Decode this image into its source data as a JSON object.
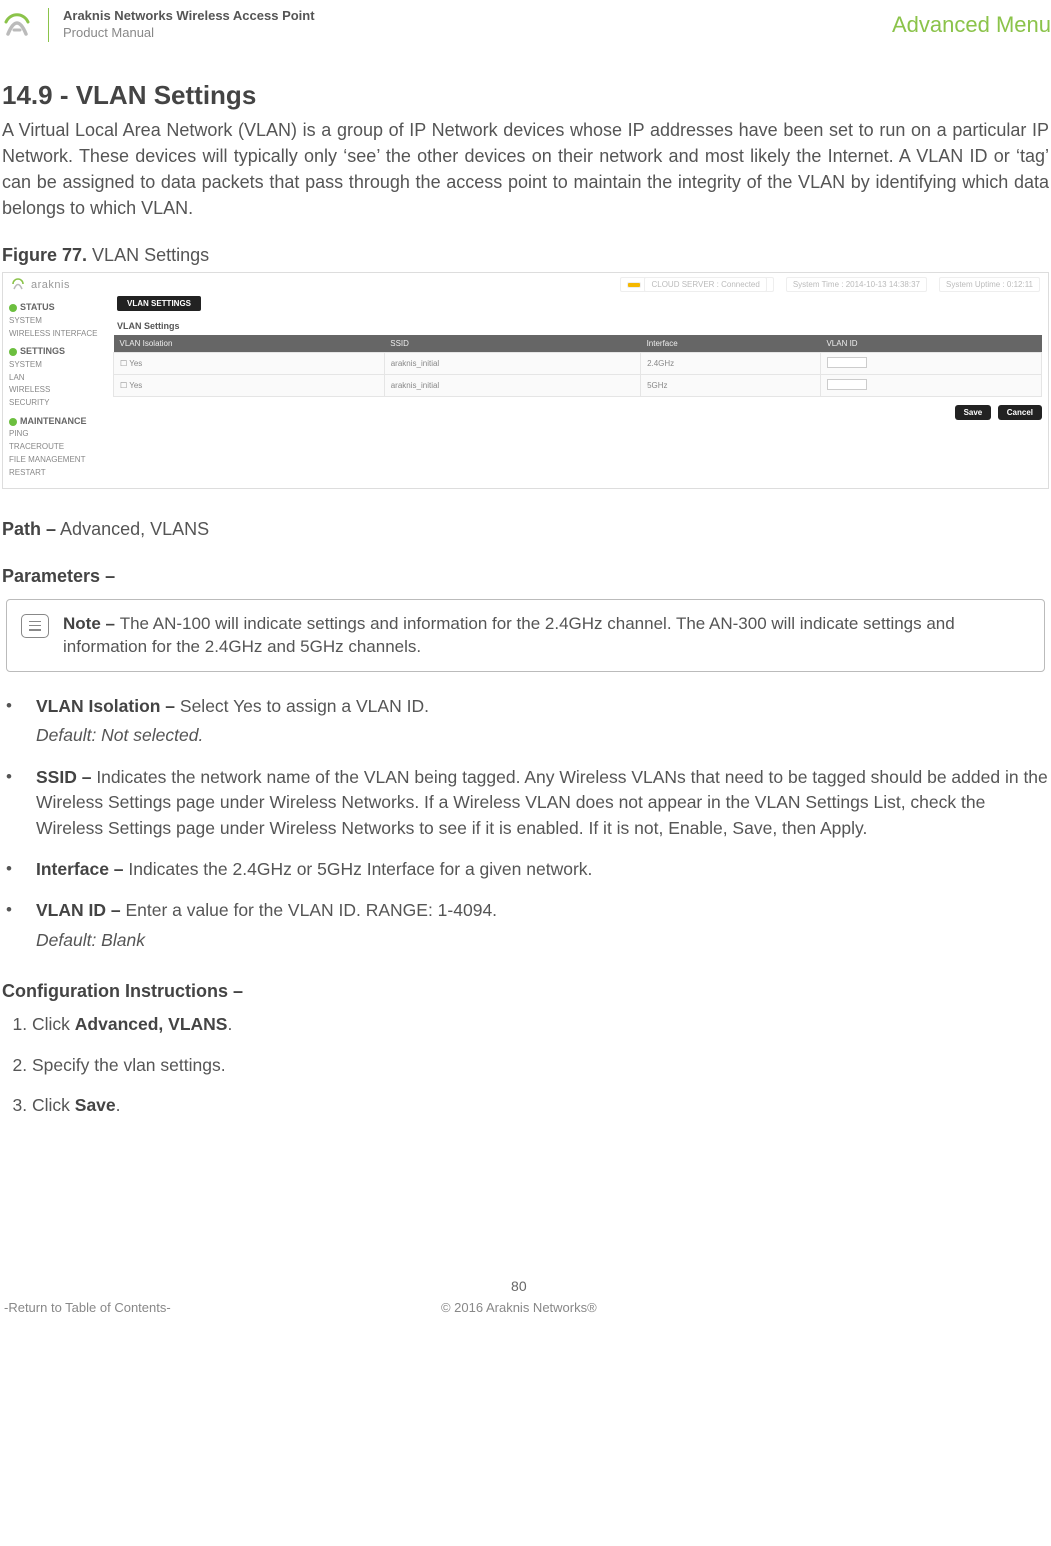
{
  "header": {
    "product_line1": "Araknis Networks Wireless Access Point",
    "product_line2": "Product Manual",
    "right_label": "Advanced Menu"
  },
  "section": {
    "title": "14.9 - VLAN Settings",
    "intro": "A Virtual Local Area Network (VLAN) is a group of IP Network devices whose IP addresses have been set to run on a particular IP Network. These devices will typically only ‘see’ the other devices on their network and most likely the Internet. A VLAN ID or ‘tag’ can be assigned to data packets that pass through the access point to maintain the integrity of the VLAN by identifying which data belongs to which VLAN."
  },
  "figure": {
    "label_bold": "Figure 77.",
    "label_rest": "VLAN Settings"
  },
  "screenshot": {
    "brand": "araknis",
    "top_right": {
      "cloud": "CLOUD SERVER : Connected",
      "time": "System Time : 2014-10-13 14:38:37",
      "uptime": "System Uptime : 0:12:11"
    },
    "sidebar": {
      "g1": {
        "head": "STATUS",
        "items": [
          "SYSTEM",
          "WIRELESS INTERFACE"
        ]
      },
      "g2": {
        "head": "SETTINGS",
        "items": [
          "SYSTEM",
          "LAN",
          "WIRELESS",
          "SECURITY"
        ]
      },
      "g3": {
        "head": "MAINTENANCE",
        "items": [
          "PING",
          "TRACEROUTE",
          "FILE MANAGEMENT",
          "RESTART"
        ]
      }
    },
    "tab": "VLAN SETTINGS",
    "subhead": "VLAN Settings",
    "table": {
      "headers": [
        "VLAN Isolation",
        "SSID",
        "Interface",
        "VLAN ID"
      ],
      "rows": [
        {
          "iso": "Yes",
          "ssid": "araknis_initial",
          "iface": "2.4GHz"
        },
        {
          "iso": "Yes",
          "ssid": "araknis_initial",
          "iface": "5GHz"
        }
      ]
    },
    "buttons": {
      "save": "Save",
      "cancel": "Cancel"
    }
  },
  "path": {
    "label": "Path –",
    "value": "Advanced, VLANS"
  },
  "parameters_head": "Parameters –",
  "note": {
    "label": "Note – ",
    "text": "The AN-100 will indicate settings and information for the 2.4GHz channel. The AN-300 will indicate settings and information for the 2.4GHz and 5GHz channels."
  },
  "params": [
    {
      "bold": "VLAN Isolation – ",
      "text": "Select Yes to assign a VLAN ID.",
      "ital": "Default: Not selected."
    },
    {
      "bold": "SSID – ",
      "text": "Indicates the network name of the VLAN being tagged. Any Wireless VLANs that need to be tagged should be added in the Wireless Settings page under Wireless Networks. If a Wireless VLAN does not appear in the VLAN Settings List, check the Wireless Settings page under Wireless Networks to see if it is enabled. If it is not, Enable, Save, then Apply."
    },
    {
      "bold": "Interface – ",
      "text": "Indicates the 2.4GHz or 5GHz Interface for a given network."
    },
    {
      "bold": "VLAN ID – ",
      "text": "Enter a value for the VLAN ID. RANGE: 1-4094.",
      "ital": "Default: Blank"
    }
  ],
  "config": {
    "head": "Configuration Instructions –",
    "steps": [
      {
        "pre": "Click ",
        "bold": "Advanced, VLANS",
        "post": "."
      },
      {
        "pre": "Specify the vlan settings.",
        "bold": "",
        "post": ""
      },
      {
        "pre": "Click ",
        "bold": "Save",
        "post": "."
      }
    ]
  },
  "footer": {
    "left": "-Return to Table of Contents-",
    "page": "80",
    "copyright": "© 2016 Araknis Networks®"
  }
}
